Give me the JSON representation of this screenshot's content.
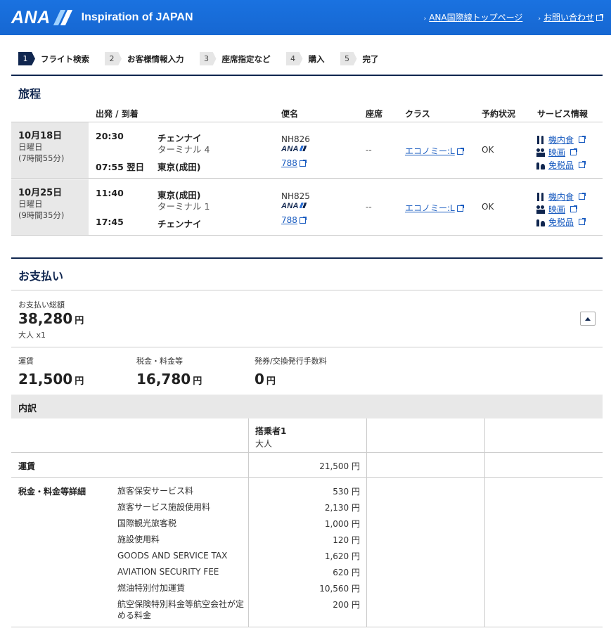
{
  "header": {
    "logo_text": "ANA",
    "tagline": "Inspiration of JAPAN",
    "links": [
      "ANA国際線トップページ",
      "お問い合わせ"
    ]
  },
  "steps": [
    {
      "num": "1",
      "label": "フライト検索",
      "active": true
    },
    {
      "num": "2",
      "label": "お客様情報入力",
      "active": false
    },
    {
      "num": "3",
      "label": "座席指定など",
      "active": false
    },
    {
      "num": "4",
      "label": "購入",
      "active": false
    },
    {
      "num": "5",
      "label": "完了",
      "active": false
    }
  ],
  "itinerary": {
    "title": "旅程",
    "columns": {
      "dep_arr": "出発 / 到着",
      "flight": "便名",
      "seat": "座席",
      "class": "クラス",
      "status": "予約状況",
      "service": "サービス情報"
    },
    "flights": [
      {
        "date": "10月18日",
        "weekday": "日曜日",
        "duration": "(7時間55分)",
        "dep_time": "20:30",
        "dep_city": "チェンナイ",
        "dep_terminal": "ターミナル 4",
        "arr_time": "07:55 翌日",
        "arr_city": "東京(成田)",
        "flight_no": "NH826",
        "airline": "ANA",
        "aircraft": "788",
        "seat": "--",
        "class": "エコノミー:L",
        "status": "OK",
        "services": [
          "機内食",
          "映画",
          "免税品"
        ]
      },
      {
        "date": "10月25日",
        "weekday": "日曜日",
        "duration": "(9時間35分)",
        "dep_time": "11:40",
        "dep_city": "東京(成田)",
        "dep_terminal": "ターミナル 1",
        "arr_time": "17:45",
        "arr_city": "チェンナイ",
        "flight_no": "NH825",
        "airline": "ANA",
        "aircraft": "788",
        "seat": "--",
        "class": "エコノミー:L",
        "status": "OK",
        "services": [
          "機内食",
          "映画",
          "免税品"
        ]
      }
    ]
  },
  "payment": {
    "title": "お支払い",
    "total_label": "お支払い総額",
    "total": "38,280",
    "currency": "円",
    "passengers": "大人 x1",
    "fare_label": "運賃",
    "fare": "21,500",
    "tax_label": "税金・料金等",
    "tax": "16,780",
    "issue_fee_label": "発券/交換発行手数料",
    "issue_fee": "0"
  },
  "breakdown": {
    "title": "内訳",
    "passenger_label": "搭乗者1",
    "passenger_type": "大人",
    "fare_label": "運賃",
    "fare_value": "21,500 円",
    "tax_label": "税金・料金等詳細",
    "taxes": [
      {
        "name": "旅客保安サービス料",
        "value": "530 円"
      },
      {
        "name": "旅客サービス施設使用料",
        "value": "2,130 円"
      },
      {
        "name": "国際観光旅客税",
        "value": "1,000 円"
      },
      {
        "name": "施設使用料",
        "value": "120 円"
      },
      {
        "name": "GOODS AND SERVICE TAX",
        "value": "1,620 円"
      },
      {
        "name": "AVIATION SECURITY FEE",
        "value": "620 円"
      },
      {
        "name": "燃油特別付加運賃",
        "value": "10,560 円"
      },
      {
        "name": "航空保険特別料金等航空会社が定める料金",
        "value": "200 円"
      }
    ]
  }
}
